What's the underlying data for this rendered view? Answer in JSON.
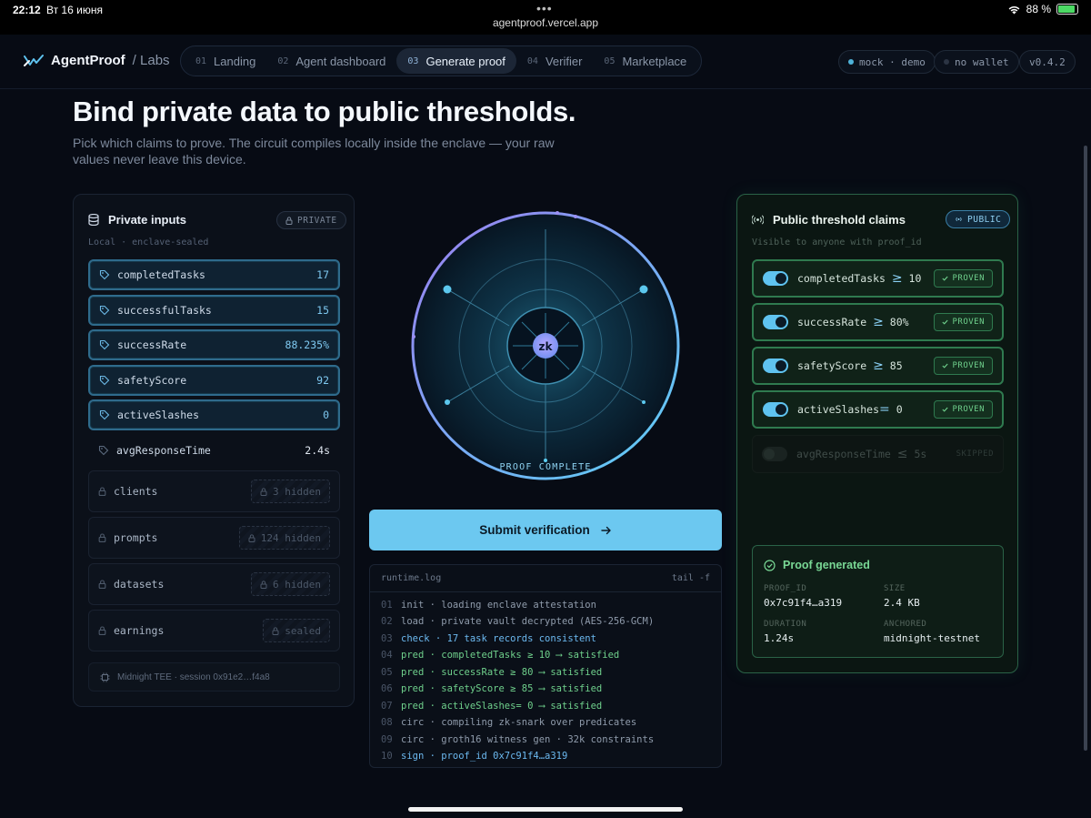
{
  "status_bar": {
    "time": "22:12",
    "date": "Вт 16 июня",
    "url": "agentproof.vercel.app",
    "battery": "88 %",
    "battery_level": 0.88
  },
  "nav": {
    "brand": "AgentProof",
    "brand_sub": "/ Labs",
    "tabs": [
      {
        "num": "01",
        "label": "Landing"
      },
      {
        "num": "02",
        "label": "Agent dashboard"
      },
      {
        "num": "03",
        "label": "Generate proof"
      },
      {
        "num": "04",
        "label": "Verifier"
      },
      {
        "num": "05",
        "label": "Marketplace"
      }
    ],
    "mode": "mock · demo",
    "wallet": "no wallet",
    "version": "v0.4.2"
  },
  "hero": {
    "title": "Bind private data to public thresholds.",
    "subtitle": "Pick which claims to prove. The circuit compiles locally inside the enclave — your raw values never leave this device."
  },
  "private_inputs": {
    "title": "Private inputs",
    "badge": "PRIVATE",
    "subtitle": "Local · enclave-sealed",
    "items": [
      {
        "label": "completedTasks",
        "value": "17"
      },
      {
        "label": "successfulTasks",
        "value": "15"
      },
      {
        "label": "successRate",
        "value": "88.235%"
      },
      {
        "label": "safetyScore",
        "value": "92"
      },
      {
        "label": "activeSlashes",
        "value": "0"
      },
      {
        "label": "avgResponseTime",
        "value": "2.4s"
      }
    ],
    "hidden": [
      {
        "label": "clients",
        "value": "3 hidden"
      },
      {
        "label": "prompts",
        "value": "124 hidden"
      },
      {
        "label": "datasets",
        "value": "6 hidden"
      },
      {
        "label": "earnings",
        "value": "sealed"
      }
    ],
    "session": "Midnight TEE · session 0x91e2…f4a8"
  },
  "ring": {
    "center": "zk",
    "label": "PROOF COMPLETE"
  },
  "submit_label": "Submit verification",
  "runtime_log": {
    "title": "runtime.log",
    "action": "tail -f",
    "lines": [
      {
        "n": "01",
        "kind": "init",
        "text": "init · loading enclave attestation"
      },
      {
        "n": "02",
        "kind": "init",
        "text": "load · private vault decrypted (AES-256-GCM)"
      },
      {
        "n": "03",
        "kind": "check",
        "text": "check · 17 task records consistent"
      },
      {
        "n": "04",
        "kind": "pred",
        "text": "pred · completedTasks ≥ 10 ⟶ satisfied"
      },
      {
        "n": "05",
        "kind": "pred",
        "text": "pred · successRate ≥ 80 ⟶ satisfied"
      },
      {
        "n": "06",
        "kind": "pred",
        "text": "pred · safetyScore ≥ 85 ⟶ satisfied"
      },
      {
        "n": "07",
        "kind": "pred",
        "text": "pred · activeSlashes= 0 ⟶ satisfied"
      },
      {
        "n": "08",
        "kind": "circ",
        "text": "circ · compiling zk-snark over predicates"
      },
      {
        "n": "09",
        "kind": "circ",
        "text": "circ · groth16 witness gen · 32k constraints"
      },
      {
        "n": "10",
        "kind": "sign",
        "text": "sign · proof_id 0x7c91f4…a319"
      }
    ]
  },
  "public_claims": {
    "title": "Public threshold claims",
    "badge": "PUBLIC",
    "subtitle": "Visible to anyone with proof_id",
    "claims": [
      {
        "label": "completedTasks",
        "op": "≥",
        "value": "10",
        "status": "PROVEN"
      },
      {
        "label": "successRate",
        "op": "≥",
        "value": "80%",
        "status": "PROVEN"
      },
      {
        "label": "safetyScore",
        "op": "≥",
        "value": "85",
        "status": "PROVEN"
      },
      {
        "label": "activeSlashes",
        "op": "=",
        "value": "0",
        "status": "PROVEN"
      },
      {
        "label": "avgResponseTime",
        "op": "≤",
        "value": "5s",
        "status": "SKIPPED"
      }
    ],
    "proof": {
      "title": "Proof generated",
      "proof_id_label": "PROOF_ID",
      "proof_id": "0x7c91f4…a319",
      "size_label": "SIZE",
      "size": "2.4 KB",
      "duration_label": "DURATION",
      "duration": "1.24s",
      "anchored_label": "ANCHORED",
      "anchored": "midnight-testnet"
    }
  },
  "colors": {
    "accent": "#6cc8f0",
    "proven": "#6fd08c",
    "background": "#070b14"
  }
}
